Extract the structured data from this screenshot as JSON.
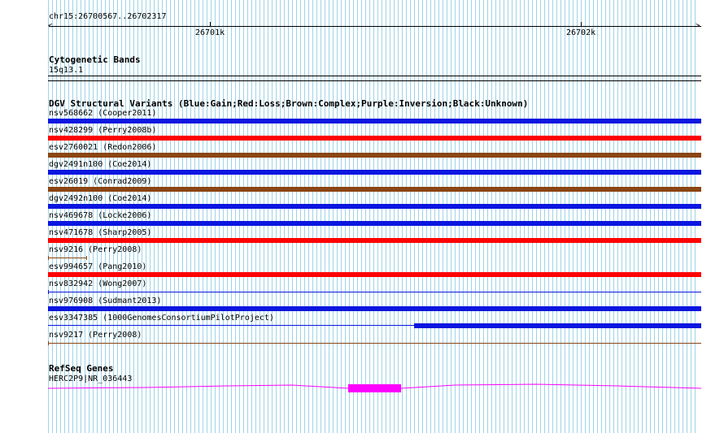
{
  "ruler": {
    "location": "chr15:26700567..26702317",
    "ticks": [
      "26701k",
      "26702k"
    ]
  },
  "cytoband": {
    "title": "Cytogenetic Bands",
    "label": "15q13.1"
  },
  "dgv": {
    "title": "DGV Structural Variants (Blue:Gain;Red:Loss;Brown:Complex;Purple:Inversion;Black:Unknown)",
    "colors": {
      "gain": "#0a16e0",
      "loss": "#ff0000",
      "complex": "#8b4513",
      "unknown": "#000000"
    },
    "variants": [
      {
        "label": "nsv568662 (Cooper2011)",
        "type": "gain",
        "start_frac": 0.0,
        "end_frac": 1.0
      },
      {
        "label": "nsv428299 (Perry2008b)",
        "type": "loss",
        "start_frac": 0.0,
        "end_frac": 1.0
      },
      {
        "label": "esv2760021 (Redon2006)",
        "type": "complex",
        "start_frac": 0.0,
        "end_frac": 1.0
      },
      {
        "label": "dgv2491n100 (Coe2014)",
        "type": "gain",
        "start_frac": 0.0,
        "end_frac": 1.0
      },
      {
        "label": "esv26019 (Conrad2009)",
        "type": "complex",
        "start_frac": 0.0,
        "end_frac": 1.0
      },
      {
        "label": "dgv2492n100 (Coe2014)",
        "type": "gain",
        "start_frac": 0.0,
        "end_frac": 1.0
      },
      {
        "label": "nsv469678 (Locke2006)",
        "type": "gain",
        "start_frac": 0.0,
        "end_frac": 1.0
      },
      {
        "label": "nsv471678 (Sharp2005)",
        "type": "loss",
        "start_frac": 0.0,
        "end_frac": 1.0
      },
      {
        "label": "nsv9216 (Perry2008)",
        "type": "complex",
        "start_frac": 0.0,
        "end_frac": 0.06,
        "style": "thin"
      },
      {
        "label": "esv994657 (Pang2010)",
        "type": "loss",
        "start_frac": 0.0,
        "end_frac": 1.0
      },
      {
        "label": "nsv832942 (Wong2007)",
        "type": "gain",
        "start_frac": 0.0,
        "end_frac": 1.0,
        "style": "thin"
      },
      {
        "label": "nsv976908 (Sudmant2013)",
        "type": "gain",
        "start_frac": 0.0,
        "end_frac": 1.0
      },
      {
        "label": "esv3347385 (1000GenomesConsortiumPilotProject)",
        "type": "gain",
        "start_frac": 0.56,
        "end_frac": 1.0,
        "style": "split"
      },
      {
        "label": "nsv9217 (Perry2008)",
        "type": "complex",
        "start_frac": 0.0,
        "end_frac": 1.0,
        "style": "thin"
      }
    ]
  },
  "refseq": {
    "title": "RefSeq Genes",
    "gene_label": "HERC2P9|NR_036443",
    "color": "#ff00ff",
    "exon_start_frac": 0.46,
    "exon_end_frac": 0.54
  }
}
